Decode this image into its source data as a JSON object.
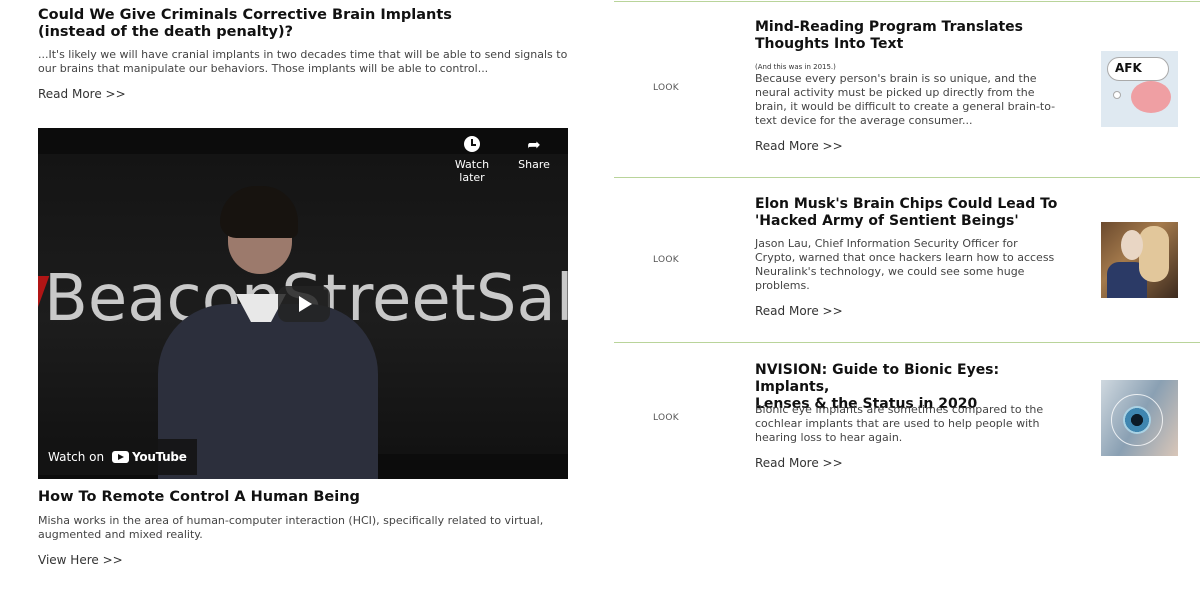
{
  "left": {
    "article1": {
      "title_line1": "Could We Give Criminals Corrective Brain Implants",
      "title_line2": "(instead of the death penalty)?",
      "excerpt": "...It's likely we will have cranial implants in two decades time that will be able to send signals to our brains that manipulate our behaviors. Those implants will be able to control...",
      "more": "Read More >>"
    },
    "video": {
      "watch_later": "Watch later",
      "share": "Share",
      "watch_on": "Watch on",
      "youtube": "YouTube",
      "backdrop_text": "BeaconStreetSalon"
    },
    "article2": {
      "title": "How To Remote Control A Human Being",
      "excerpt": "Misha works in the area of human-computer interaction (HCI), specifically related to virtual, augmented and mixed reality.",
      "more": "View Here >>"
    }
  },
  "right": {
    "items": [
      {
        "look": "LOOK",
        "title_line1": "Mind-Reading Program Translates",
        "title_line2": "Thoughts Into Text",
        "note": "(And this was in 2015.)",
        "excerpt": "Because every person's brain is so unique, and the neural activity must be picked up directly from the brain, it would be difficult to create a general brain-to-text device for the average consumer...",
        "more": "Read More >>",
        "thumb_text": "AFK"
      },
      {
        "look": "LOOK",
        "title_line1": "Elon Musk's Brain Chips Could Lead To",
        "title_line2": "'Hacked Army of Sentient Beings'",
        "excerpt": "Jason Lau, Chief Information Security Officer for Crypto, warned that once hackers learn how to access Neuralink's technology, we could see some huge problems.",
        "more": "Read More >>"
      },
      {
        "look": "LOOK",
        "title_line1": "NVISION: Guide to Bionic Eyes: Implants,",
        "title_line2": "Lenses & the Status in 2020",
        "excerpt": "Bionic eye implants are sometimes compared to the cochlear implants that are used to help people with hearing loss to hear again.",
        "more": "Read More >>"
      }
    ]
  },
  "colors": {
    "divider": "#b9d49a",
    "video_bg": "#0c0c0c"
  }
}
